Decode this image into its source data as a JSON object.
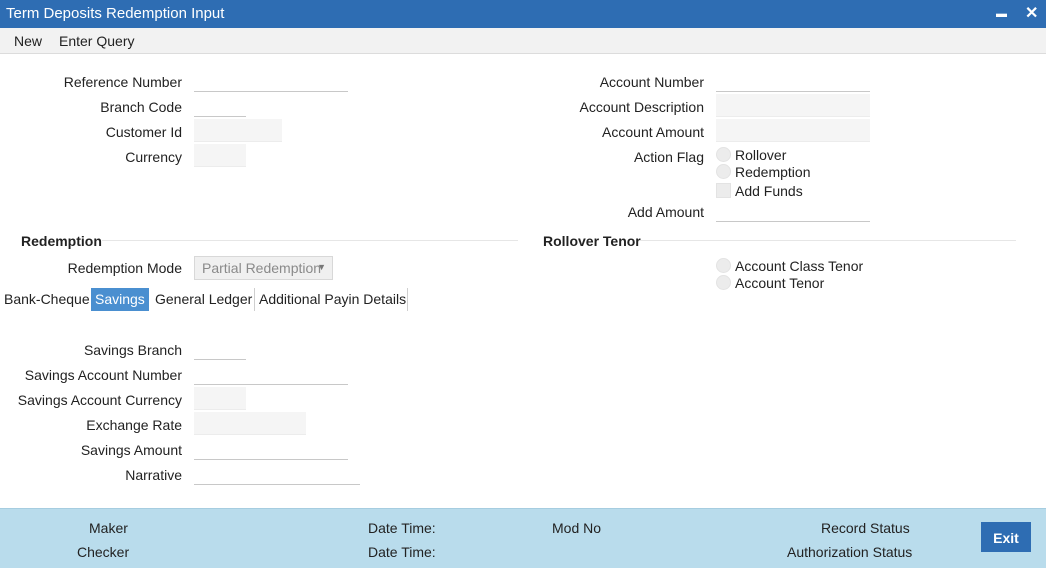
{
  "window": {
    "title": "Term Deposits Redemption Input",
    "minimize": "▬",
    "close": "✕"
  },
  "menu": {
    "new": "New",
    "enter_query": "Enter Query"
  },
  "header_left": {
    "reference_number": {
      "label": "Reference Number",
      "value": ""
    },
    "branch_code": {
      "label": "Branch Code",
      "value": ""
    },
    "customer_id": {
      "label": "Customer Id",
      "value": ""
    },
    "currency": {
      "label": "Currency",
      "value": ""
    }
  },
  "header_right": {
    "account_number": {
      "label": "Account Number",
      "value": ""
    },
    "account_description": {
      "label": "Account Description",
      "value": ""
    },
    "account_amount": {
      "label": "Account Amount",
      "value": ""
    },
    "action_flag": {
      "label": "Action Flag",
      "options": [
        "Rollover",
        "Redemption"
      ],
      "add_funds": "Add Funds"
    },
    "add_amount": {
      "label": "Add Amount",
      "value": ""
    }
  },
  "redemption": {
    "section_title": "Redemption",
    "mode_label": "Redemption Mode",
    "mode_value": "Partial Redemption",
    "tabs": [
      "Bank-Cheque",
      "Savings",
      "General Ledger",
      "Additional Payin Details"
    ],
    "active_tab": "Savings"
  },
  "rollover_tenor": {
    "section_title": "Rollover Tenor",
    "options": [
      "Account Class Tenor",
      "Account Tenor"
    ]
  },
  "savings": {
    "savings_branch": {
      "label": "Savings Branch",
      "value": ""
    },
    "savings_account_number": {
      "label": "Savings Account Number",
      "value": ""
    },
    "savings_account_currency": {
      "label": "Savings Account Currency",
      "value": ""
    },
    "exchange_rate": {
      "label": "Exchange Rate",
      "value": ""
    },
    "savings_amount": {
      "label": "Savings Amount",
      "value": ""
    },
    "narrative": {
      "label": "Narrative",
      "value": ""
    }
  },
  "footer": {
    "maker": "Maker",
    "checker": "Checker",
    "date_time_1": "Date Time:",
    "date_time_2": "Date Time:",
    "mod_no": "Mod No",
    "record_status": "Record Status",
    "authorization_status": "Authorization Status",
    "exit": "Exit"
  },
  "colors": {
    "titlebar": "#2e6db3",
    "active_tab": "#4a8fd0",
    "footer": "#b9dcec",
    "exit_button": "#2e6db3"
  }
}
